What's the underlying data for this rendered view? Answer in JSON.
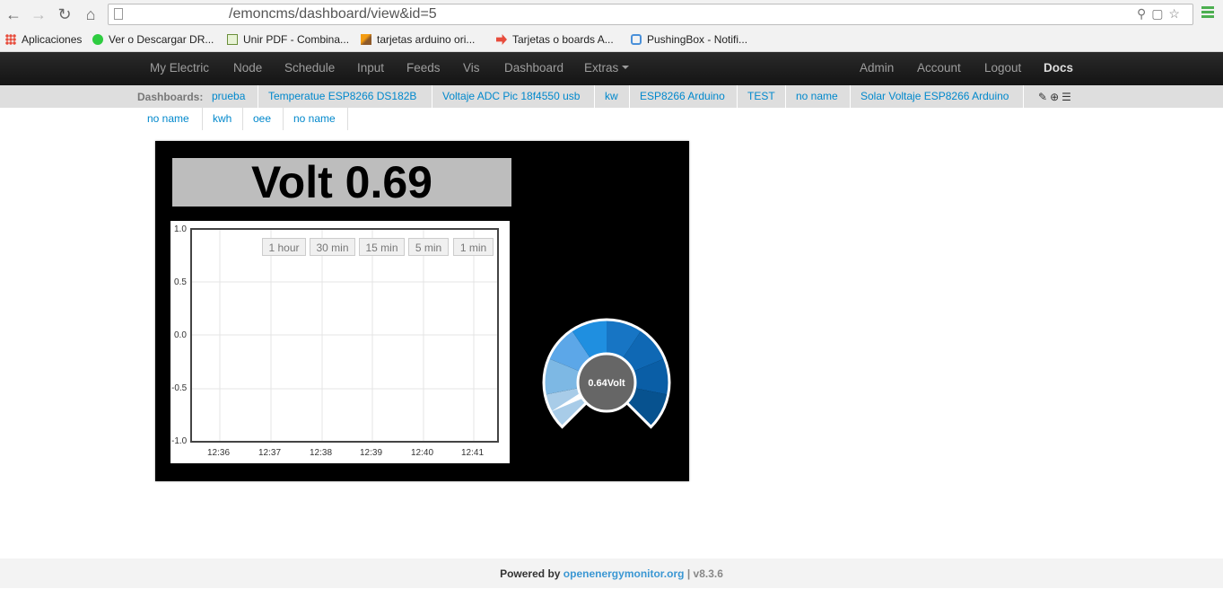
{
  "browser": {
    "url": "/emoncms/dashboard/view&id=5"
  },
  "bookmarks": [
    {
      "label": "Aplicaciones"
    },
    {
      "label": "Ver o Descargar DR..."
    },
    {
      "label": "Unir PDF - Combina..."
    },
    {
      "label": "tarjetas arduino ori..."
    },
    {
      "label": "Tarjetas o boards A..."
    },
    {
      "label": "PushingBox - Notifi..."
    }
  ],
  "nav": {
    "left": [
      "My Electric",
      "Node",
      "Schedule",
      "Input",
      "Feeds",
      "Vis",
      "Dashboard",
      "Extras"
    ],
    "right": [
      "Admin",
      "Account",
      "Logout",
      "Docs"
    ]
  },
  "dashboards": {
    "label": "Dashboards:",
    "row1": [
      "prueba",
      "Temperatue ESP8266 DS182B",
      "Voltaje ADC Pic 18f4550 usb",
      "kw",
      "ESP8266 Arduino",
      "TEST",
      "no name",
      "Solar Voltaje ESP8266 Arduino"
    ],
    "row2": [
      "no name",
      "kwh",
      "oee",
      "no name"
    ]
  },
  "widget": {
    "value_label": "Volt 0.69",
    "gauge_label": "0.64Volt",
    "gauge_value": 0.64
  },
  "graph": {
    "buttons": [
      "1 hour",
      "30 min",
      "15 min",
      "5 min",
      "1 min"
    ],
    "y_ticks": [
      "1.0",
      "0.5",
      "0.0",
      "-0.5",
      "-1.0"
    ],
    "x_ticks": [
      "12:36",
      "12:37",
      "12:38",
      "12:39",
      "12:40",
      "12:41"
    ]
  },
  "footer": {
    "powered": "Powered by",
    "link": "openenergymonitor.org",
    "version": "| v8.3.6"
  }
}
